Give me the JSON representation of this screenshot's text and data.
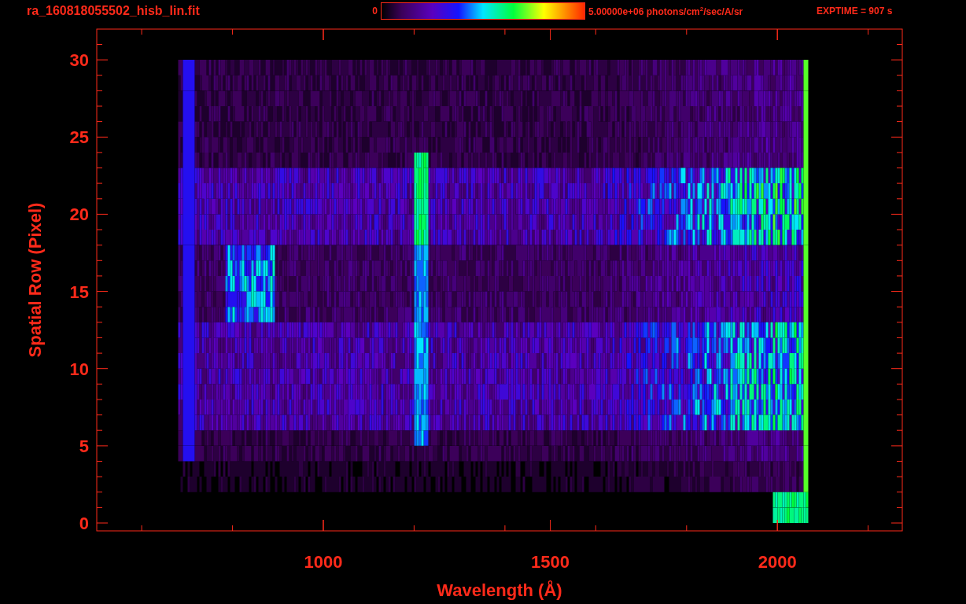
{
  "title": "ra_160818055502_hisb_lin.fit",
  "colorbar": {
    "min_label": "0",
    "max_label": "5.00000e+06 photons/cm$^{2}$/sec/A/sr"
  },
  "exposure": "EXPTIME = 907 s",
  "plot": {
    "xlabel": "Wavelength (Å)",
    "ylabel": "Spatial Row (Pixel)",
    "xtick_labels": [
      "1000",
      "1500",
      "2000"
    ],
    "ytick_labels": [
      "30",
      "25",
      "20",
      "15",
      "10",
      "5",
      "0"
    ]
  }
}
